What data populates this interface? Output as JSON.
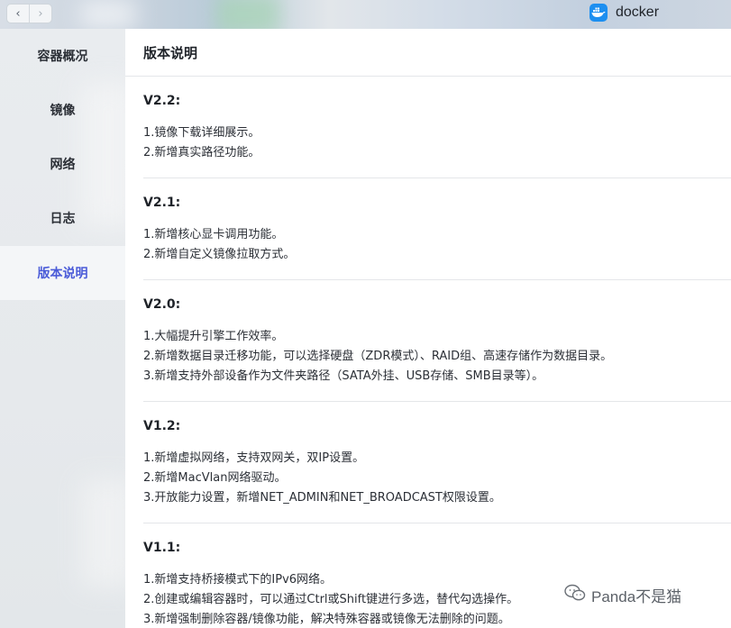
{
  "app": {
    "name": "docker",
    "icon": "docker-whale-icon",
    "accent": "#1d8ff0"
  },
  "nav": {
    "back_icon": "‹",
    "forward_icon": "›"
  },
  "sidebar": {
    "items": [
      {
        "label": "容器概况",
        "active": false
      },
      {
        "label": "镜像",
        "active": false
      },
      {
        "label": "网络",
        "active": false
      },
      {
        "label": "日志",
        "active": false
      },
      {
        "label": "版本说明",
        "active": true
      }
    ],
    "active_color": "#4a5bd8"
  },
  "main": {
    "title": "版本说明",
    "versions": [
      {
        "title": "V2.2:",
        "lines": [
          "1.镜像下载详细展示。",
          "2.新增真实路径功能。"
        ]
      },
      {
        "title": "V2.1:",
        "lines": [
          "1.新增核心显卡调用功能。",
          "2.新增自定义镜像拉取方式。"
        ]
      },
      {
        "title": "V2.0:",
        "lines": [
          "1.大幅提升引擎工作效率。",
          "2.新增数据目录迁移功能，可以选择硬盘（ZDR模式）、RAID组、高速存储作为数据目录。",
          "3.新增支持外部设备作为文件夹路径（SATA外挂、USB存储、SMB目录等）。"
        ]
      },
      {
        "title": "V1.2:",
        "lines": [
          "1.新增虚拟网络，支持双网关，双IP设置。",
          "2.新增MacVlan网络驱动。",
          "3.开放能力设置，新增NET_ADMIN和NET_BROADCAST权限设置。"
        ]
      },
      {
        "title": "V1.1:",
        "lines": [
          "1.新增支持桥接模式下的IPv6网络。",
          "2.创建或编辑容器时，可以通过Ctrl或Shift键进行多选，替代勾选操作。",
          "3.新增强制删除容器/镜像功能，解决特殊容器或镜像无法删除的问题。"
        ]
      }
    ]
  },
  "watermark": {
    "text": "Panda不是猫",
    "icon": "wechat-icon"
  }
}
